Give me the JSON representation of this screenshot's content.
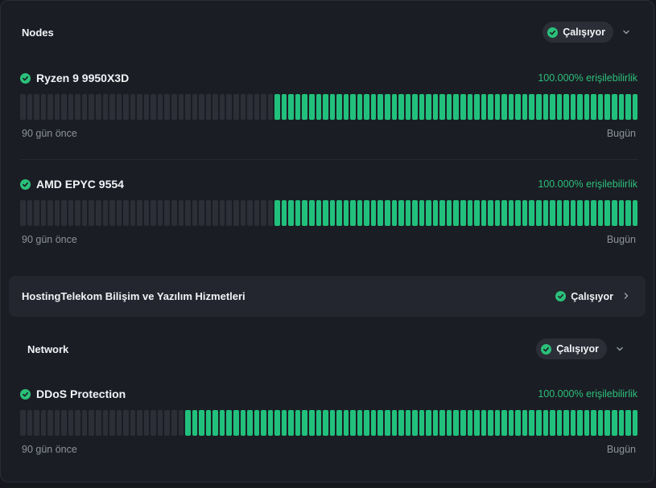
{
  "nodes": {
    "title": "Nodes",
    "status": "Çalışıyor",
    "services": [
      {
        "name": "Ryzen 9 9950X3D",
        "uptime": "100.000% erişilebilirlik",
        "start_label": "90 gün önce",
        "end_label": "Bugün",
        "total_bars": 90,
        "up_bars": 53
      },
      {
        "name": "AMD EPYC 9554",
        "uptime": "100.000% erişilebilirlik",
        "start_label": "90 gün önce",
        "end_label": "Bugün",
        "total_bars": 90,
        "up_bars": 53
      }
    ]
  },
  "group": {
    "title": "HostingTelekom Bilişim ve Yazılım Hizmetleri",
    "status": "Çalışıyor"
  },
  "network": {
    "title": "Network",
    "status": "Çalışıyor",
    "services": [
      {
        "name": "DDoS Protection",
        "uptime": "100.000% erişilebilirlik",
        "start_label": "90 gün önce",
        "end_label": "Bugün",
        "total_bars": 90,
        "up_bars": 66
      }
    ]
  },
  "colors": {
    "up": "#21c07c",
    "empty": "#2c2f38",
    "accent": "#2bc07a"
  },
  "icons": {
    "status": "check-circle-icon",
    "expand": "chevron-down-icon",
    "navigate": "chevron-right-icon"
  }
}
